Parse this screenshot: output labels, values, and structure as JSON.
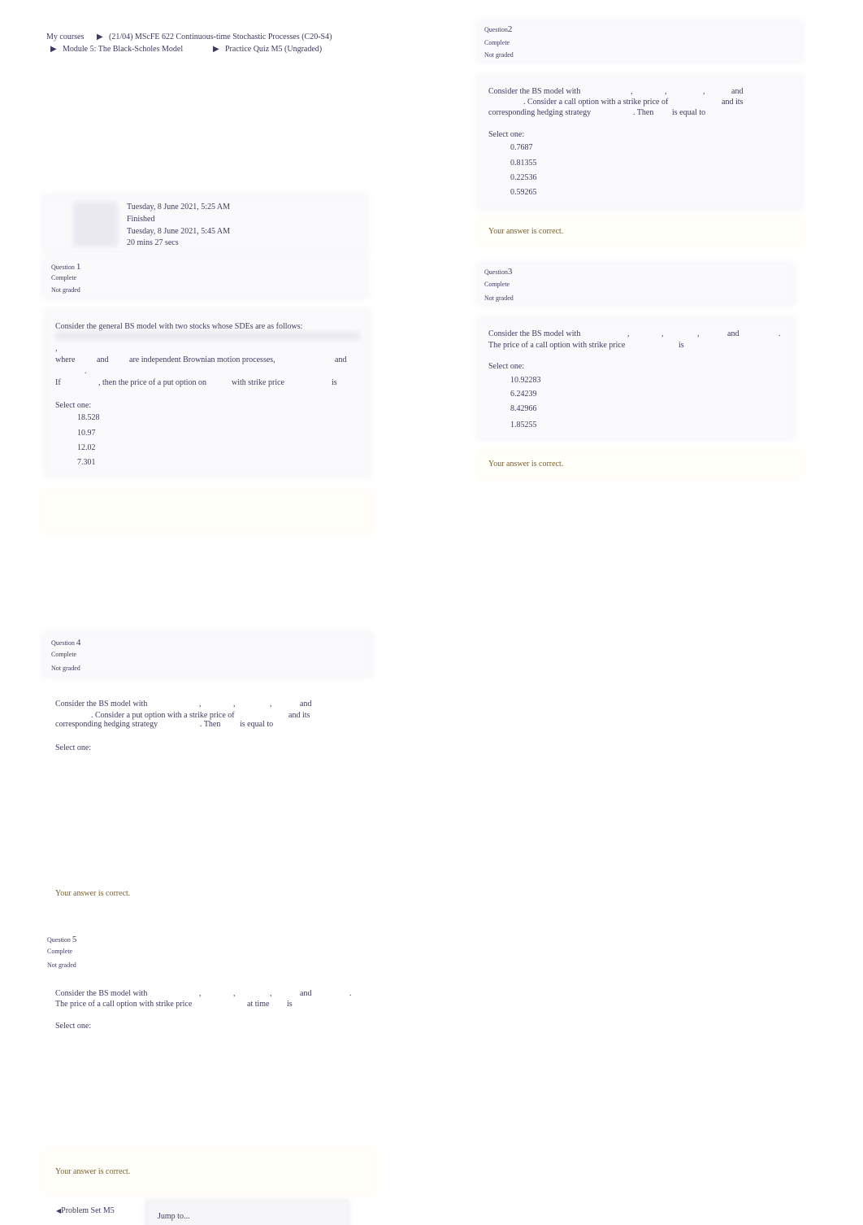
{
  "breadcrumb": {
    "items": [
      "My courses",
      "(21/04) MScFE 622 Continuous-time Stochastic Processes (C20-S4)",
      "Module 5: The Black-Scholes Model",
      "Practice Quiz M5 (Ungraded)"
    ]
  },
  "summary": {
    "started": "Tuesday, 8 June 2021, 5:25 AM",
    "state": "Finished",
    "completed": "Tuesday, 8 June 2021, 5:45 AM",
    "time_taken": "20 mins 27 secs"
  },
  "common": {
    "question": "Question",
    "complete": "Complete",
    "not_graded": "Not graded",
    "select_one": "Select one:",
    "feedback": "Your answer is correct."
  },
  "q1": {
    "number": "1",
    "l1": "Consider the general BS model with two stocks whose SDEs are as follows:",
    "comma": ",",
    "where": "where",
    "and1": "and",
    "indep": "are independent Brownian motion processes,",
    "and2": "and",
    "dot": ".",
    "if": "If",
    "then": ", then the price of a put option on",
    "strike": "with strike price",
    "is": "is",
    "options": [
      "18.528",
      "10.97",
      "12.02",
      "7.301"
    ]
  },
  "q2": {
    "number": "2",
    "l1a": "Consider the BS model with",
    "c1": ",",
    "c2": ",",
    "c3": ",",
    "and": "and",
    "l2a": ". Consider a call option with a strike price of",
    "l2b": "and its",
    "l3a": "corresponding hedging strategy",
    "l3b": ". Then",
    "l3c": "is equal to",
    "options": [
      "0.7687",
      "0.81355",
      "0.22536",
      "0.59265"
    ]
  },
  "q3": {
    "number": "3",
    "l1a": "Consider the BS model with",
    "c1": ",",
    "c2": ",",
    "c3": ",",
    "and": "and",
    "dot": ".",
    "l2a": "The price of a call option with strike price",
    "l2b": "is",
    "options": [
      "10.92283",
      "6.24239",
      "8.42966",
      "1.85255"
    ]
  },
  "q4": {
    "number": "4",
    "l1a": "Consider the BS model with",
    "c1": ",",
    "c2": ",",
    "c3": ",",
    "and": "and",
    "l2a": ". Consider a put option with a strike price of",
    "l2b": "and its",
    "l3a": "corresponding hedging strategy",
    "l3b": ". Then",
    "l3c": "is equal to"
  },
  "q5": {
    "number": "5",
    "l1a": "Consider the BS model with",
    "c1": ",",
    "c2": ",",
    "c3": ",",
    "and": "and",
    "dot": ".",
    "l2a": "The price of a call option with strike price",
    "l2b": "at time",
    "l2c": "is"
  },
  "footer": {
    "prev_link": "Problem Set M5",
    "jump_to": "Jump to..."
  }
}
